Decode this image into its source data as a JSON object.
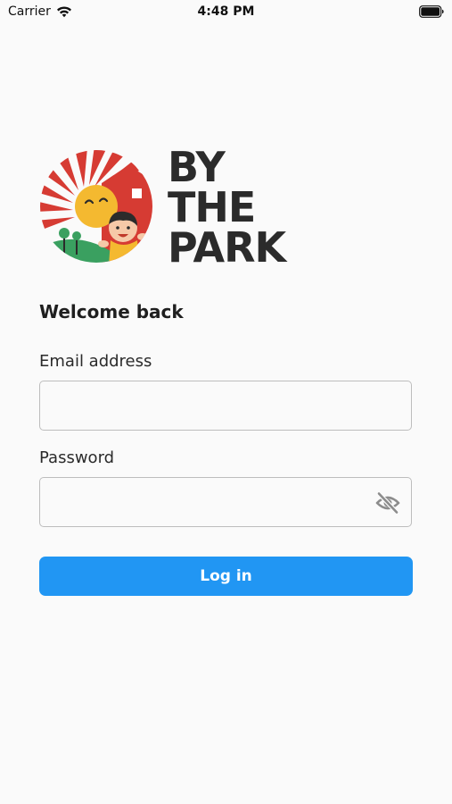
{
  "status_bar": {
    "carrier": "Carrier",
    "time": "4:48 PM"
  },
  "logo": {
    "line1": "BY",
    "line2": "THE",
    "line3": "PARK"
  },
  "form": {
    "heading": "Welcome back",
    "email_label": "Email address",
    "email_value": "",
    "password_label": "Password",
    "password_value": "",
    "submit_label": "Log in"
  },
  "colors": {
    "primary": "#2196f3",
    "background": "#fafafa",
    "logo_red": "#d63b33",
    "logo_yellow": "#f4b930",
    "logo_green": "#3aa060",
    "wordmark": "#2b2b2b"
  },
  "icons": {
    "wifi": "wifi-icon",
    "battery": "battery-icon",
    "password_visibility": "eye-off-icon"
  }
}
